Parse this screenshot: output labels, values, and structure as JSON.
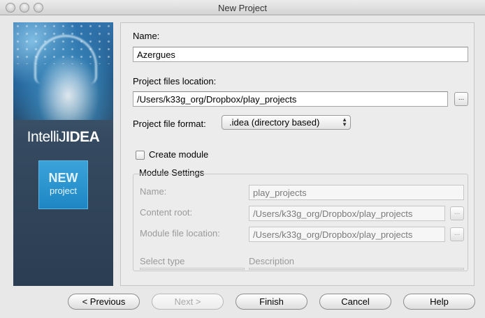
{
  "window": {
    "title": "New Project"
  },
  "banner": {
    "brand_light": "IntelliJ",
    "brand_bold": "IDEA",
    "badge_line1": "NEW",
    "badge_line2": "project"
  },
  "form": {
    "name_label": "Name:",
    "name_value": "Azergues",
    "location_label": "Project files location:",
    "location_value": "/Users/k33g_org/Dropbox/play_projects",
    "browse_label": "...",
    "format_label": "Project file format:",
    "format_value": ".idea (directory based)",
    "create_module_label": "Create module",
    "create_module_checked": false
  },
  "module_settings": {
    "title": "Module Settings",
    "name_label": "Name:",
    "name_value": "play_projects",
    "content_root_label": "Content root:",
    "content_root_value": "/Users/k33g_org/Dropbox/play_projects",
    "module_file_label": "Module file location:",
    "module_file_value": "/Users/k33g_org/Dropbox/play_projects",
    "select_type_label": "Select type",
    "description_label": "Description",
    "browse_label": "..."
  },
  "buttons": {
    "previous": "< Previous",
    "next": "Next >",
    "finish": "Finish",
    "cancel": "Cancel",
    "help": "Help"
  }
}
